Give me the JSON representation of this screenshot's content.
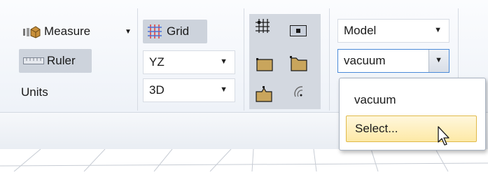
{
  "measure_group": {
    "measure_label": "Measure",
    "ruler_label": "Ruler",
    "units_label": "Units"
  },
  "grid_group": {
    "grid_label": "Grid",
    "plane_value": "YZ",
    "view_mode_value": "3D"
  },
  "material_group": {
    "type_value": "Model",
    "material_value": "vacuum"
  },
  "material_popup": {
    "options": [
      "vacuum",
      "Select..."
    ]
  },
  "colors": {
    "selected_bg": "#cdd3dc",
    "dropdown_focus_border": "#4a8ad8",
    "popup_highlight": "#fde9a6",
    "grid_icon_red": "#e0393b",
    "grid_icon_blue": "#4a6fd8",
    "folder_fill": "#c9a55c"
  },
  "icons": [
    "measure-cube-icon",
    "ruler-icon",
    "grid-icon",
    "snap-grid-icon",
    "face-view-icon",
    "folder-icon",
    "folder-open-icon",
    "folder-up-icon",
    "rotate-icon",
    "mouse-pointer-icon"
  ]
}
